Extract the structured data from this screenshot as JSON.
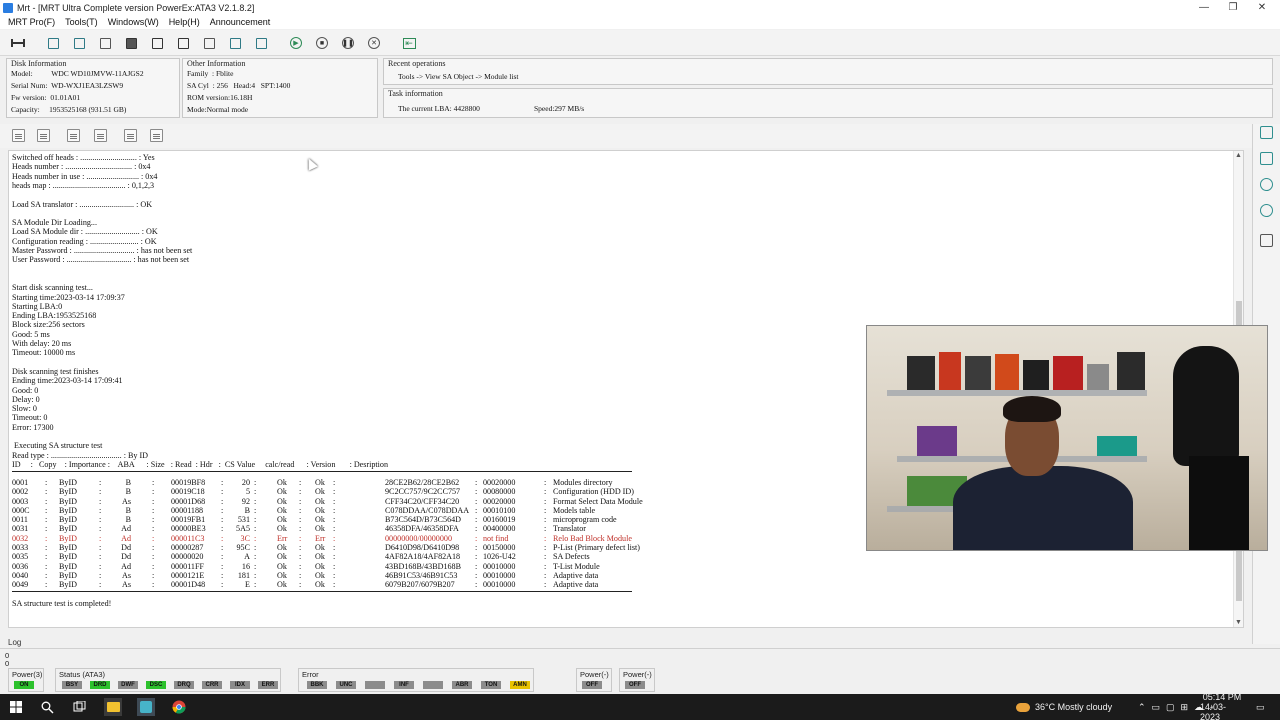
{
  "window": {
    "title": "Mrt - [MRT Ultra Complete version PowerEx:ATA3 V2.1.8.2]",
    "controls": [
      "—",
      "❐",
      "✕"
    ]
  },
  "menu": [
    "MRT Pro(F)",
    "Tools(T)",
    "Windows(W)",
    "Help(H)",
    "Announcement"
  ],
  "disk_info": {
    "header": "Disk Information",
    "rows": [
      "Model:          WDC WD10JMVW-11AJGS2",
      "Serial Num:  WD-WXJ1EA3LZSW9",
      "Fw version:  01.01A01",
      "Capacity:     1953525168 (931.51 GB)"
    ]
  },
  "other_info": {
    "header": "Other Information",
    "rows": [
      "Family  : Fblite",
      "SA Cyl  : 256   Head:4   SPT:1400",
      "ROM version:16.18H",
      "Mode:Normal mode"
    ]
  },
  "recent_ops": {
    "header": "Recent operations",
    "text": "Tools -> View SA Object -> Module list"
  },
  "task_info": {
    "header": "Task information",
    "lba": "The current LBA: 4428800",
    "speed": "Speed:297 MB/s"
  },
  "log_lines": [
    "Switched off heads : ............................ : Yes",
    "Heads number : ................................. : 0x4",
    "Heads number in use : .......................... : 0x4",
    "heads map : .................................... : 0,1,2,3",
    "",
    "Load SA translator : ........................... : OK",
    "",
    "SA Module Dir Loading...",
    "Load SA Module dir : ........................... : OK",
    "Configuration reading : ........................ : OK",
    "Master Password : .............................. : has not been set",
    "User Password : ................................ : has not been set",
    "",
    "",
    "Start disk scanning test...",
    "Starting time:2023-03-14 17:09:37",
    "Starting LBA:0",
    "Ending LBA:1953525168",
    "Block size:256 sectors",
    "Good: 5 ms",
    "With delay: 20 ms",
    "Timeout: 10000 ms",
    "",
    "Disk scanning test finishes",
    "Ending time:2023-03-14 17:09:41",
    "Good: 0",
    "Delay: 0",
    "Slow: 0",
    "Timeout: 0",
    "Error: 17300",
    "",
    " Executing SA structure test",
    "Read type : ................................... : By ID"
  ],
  "table_header": "ID     :   Copy    : Importance :    ABA      : Size   : Read  : Hdr   :  CS Value     calc/read      : Version       : Desription",
  "table_rows": [
    {
      "id": "0001",
      "copy": "ByID",
      "imp": "B",
      "aba": "00019BF8",
      "size": "20",
      "read": "Ok",
      "hdr": "Ok",
      "cs": "28CE2B62/28CE2B62",
      "ver": "00020000",
      "desc": "Modules directory",
      "err": false
    },
    {
      "id": "0002",
      "copy": "ByID",
      "imp": "B",
      "aba": "00019C18",
      "size": "5",
      "read": "Ok",
      "hdr": "Ok",
      "cs": "9C2CC757/9C2CC757",
      "ver": "00080000",
      "desc": "Configuration (HDD ID)",
      "err": false
    },
    {
      "id": "0003",
      "copy": "ByID",
      "imp": "As",
      "aba": "00001D68",
      "size": "92",
      "read": "Ok",
      "hdr": "Ok",
      "cs": "CFF34C20/CFF34C20",
      "ver": "00020000",
      "desc": "Format Select Data Module",
      "err": false
    },
    {
      "id": "000C",
      "copy": "ByID",
      "imp": "B",
      "aba": "00001188",
      "size": "B",
      "read": "Ok",
      "hdr": "Ok",
      "cs": "C078DDAA/C078DDAA",
      "ver": "00010100",
      "desc": "Models table",
      "err": false
    },
    {
      "id": "0011",
      "copy": "ByID",
      "imp": "B",
      "aba": "00019FB1",
      "size": "531",
      "read": "Ok",
      "hdr": "Ok",
      "cs": "B73C564D/B73C564D",
      "ver": "00160019",
      "desc": "microprogram code",
      "err": false
    },
    {
      "id": "0031",
      "copy": "ByID",
      "imp": "Ad",
      "aba": "00000BE3",
      "size": "5A5",
      "read": "Ok",
      "hdr": "Ok",
      "cs": "46358DFA/46358DFA",
      "ver": "00400000",
      "desc": "Translator",
      "err": false
    },
    {
      "id": "0032",
      "copy": "ByID",
      "imp": "Ad",
      "aba": "000011C3",
      "size": "3C",
      "read": "Err",
      "hdr": "Err",
      "cs": "00000000/00000000",
      "ver": "not find",
      "desc": "Relo Bad Block Module",
      "err": true
    },
    {
      "id": "0033",
      "copy": "ByID",
      "imp": "Dd",
      "aba": "00000287",
      "size": "95C",
      "read": "Ok",
      "hdr": "Ok",
      "cs": "D6410D98/D6410D98",
      "ver": "00150000",
      "desc": "P-List (Primary defect list)",
      "err": false
    },
    {
      "id": "0035",
      "copy": "ByID",
      "imp": "Dd",
      "aba": "00000020",
      "size": "A",
      "read": "Ok",
      "hdr": "Ok",
      "cs": "4AF82A18/4AF82A18",
      "ver": "1026-U42",
      "desc": "SA Defects",
      "err": false
    },
    {
      "id": "0036",
      "copy": "ByID",
      "imp": "Ad",
      "aba": "000011FF",
      "size": "16",
      "read": "Ok",
      "hdr": "Ok",
      "cs": "43BD168B/43BD168B",
      "ver": "00010000",
      "desc": "T-List Module",
      "err": false
    },
    {
      "id": "0040",
      "copy": "ByID",
      "imp": "As",
      "aba": "0000121E",
      "size": "181",
      "read": "Ok",
      "hdr": "Ok",
      "cs": "46B91C53/46B91C53",
      "ver": "00010000",
      "desc": "Adaptive data",
      "err": false
    },
    {
      "id": "0049",
      "copy": "ByID",
      "imp": "As",
      "aba": "00001D48",
      "size": "E",
      "read": "Ok",
      "hdr": "Ok",
      "cs": "6079B207/6079B207",
      "ver": "00010000",
      "desc": "Adaptive data",
      "err": false
    }
  ],
  "completed_line": "SA structure test is completed!",
  "log_tab": "Log",
  "bottom_counters": [
    "0",
    "0"
  ],
  "status": {
    "power_label": "Power(3)",
    "power_chip": "ON",
    "ata_label": "Status (ATA3)",
    "ata_chips": [
      "BSY",
      "DRD",
      "DWF",
      "DSC",
      "DRQ",
      "CRR",
      "IDX",
      "ERR"
    ],
    "error_label": "Error",
    "error_chips": [
      "BBK",
      "UNC",
      "",
      "INF",
      "",
      "ABR",
      "TON",
      "AMN"
    ],
    "power2_label": "Power(-)",
    "power2_chip": "OFF",
    "power3_label": "Power(-)",
    "power3_chip": "OFF",
    "colors": {
      "on_green": "#2cc12c",
      "amber": "#e8c200",
      "chip_gray": "#8c8c8c"
    }
  },
  "taskbar": {
    "weather": "36°C  Mostly cloudy",
    "time": "05:14 PM",
    "date": "14-03-2023"
  }
}
